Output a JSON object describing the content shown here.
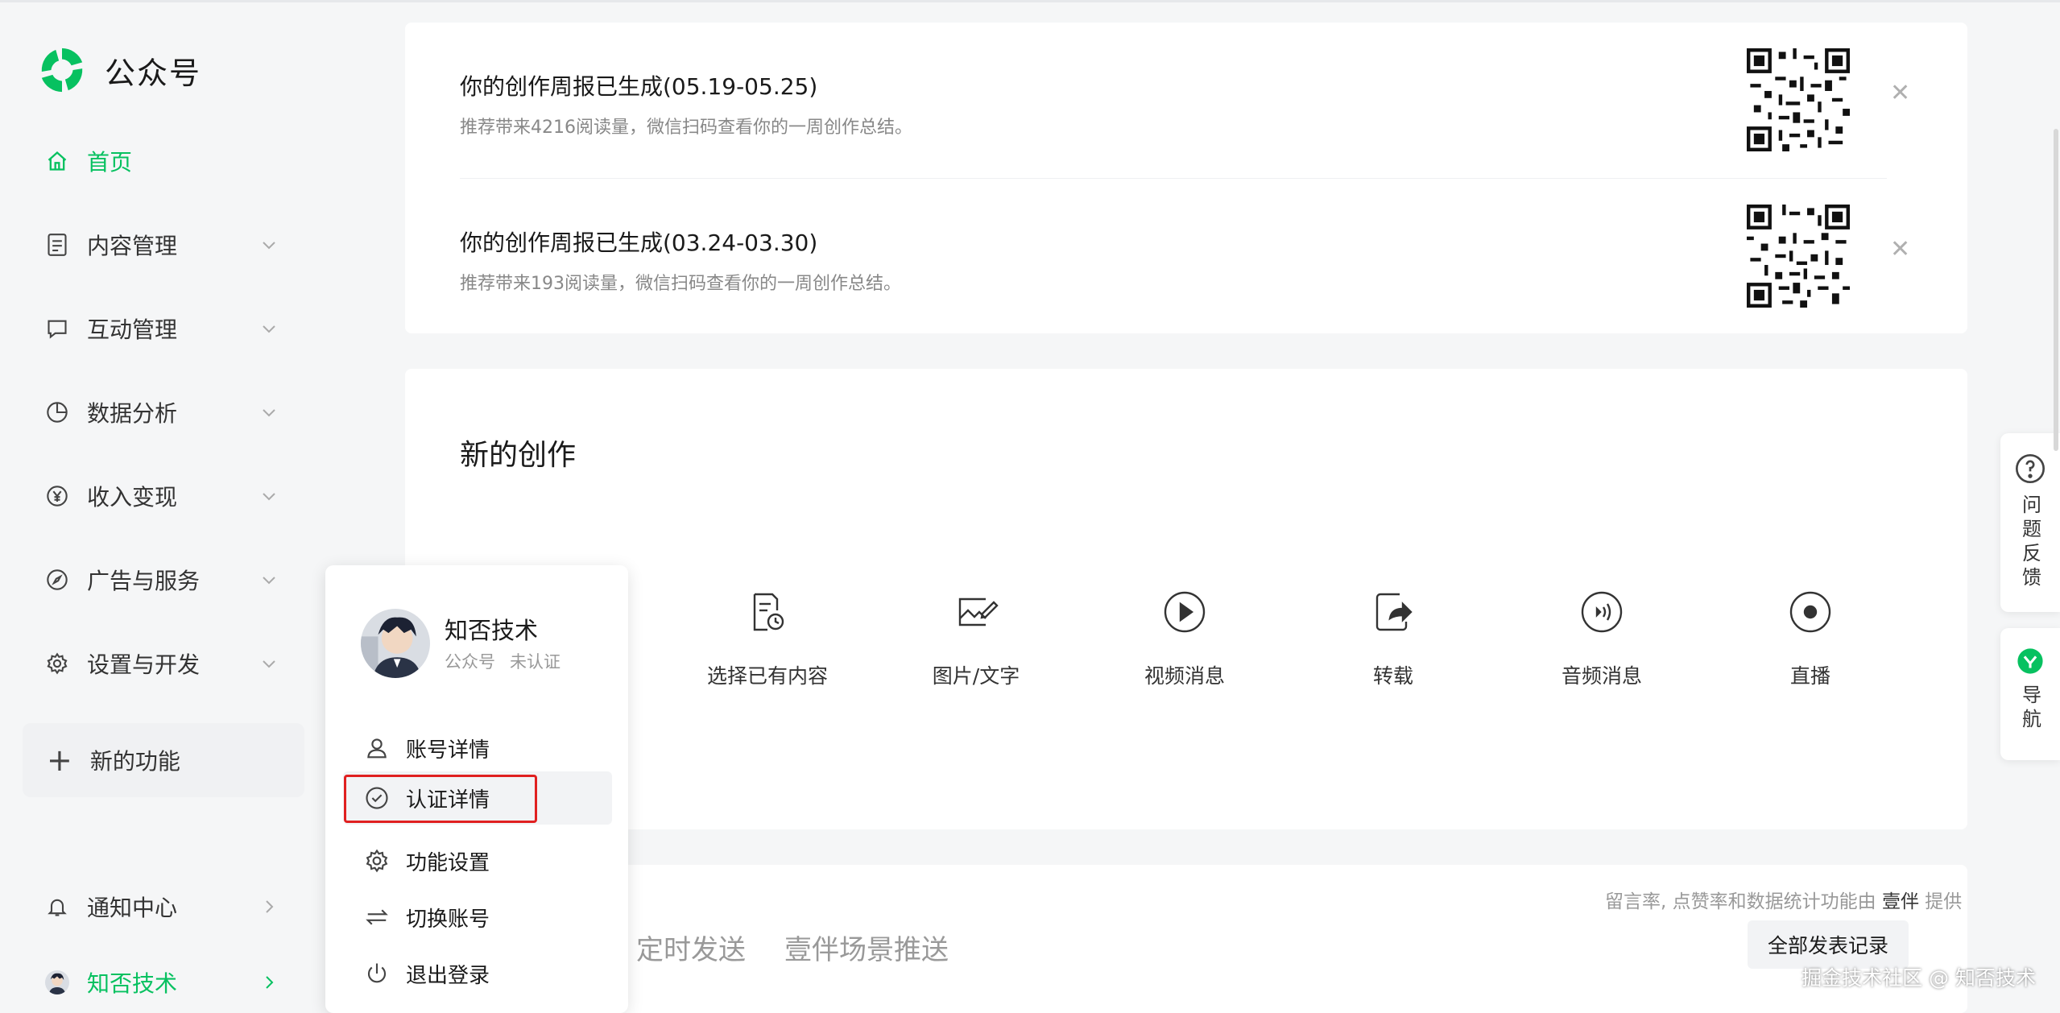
{
  "app": {
    "name": "公众号",
    "brand_color": "#07c160"
  },
  "sidebar": {
    "home": "首页",
    "items": [
      {
        "label": "内容管理",
        "icon": "document-icon"
      },
      {
        "label": "互动管理",
        "icon": "message-icon"
      },
      {
        "label": "数据分析",
        "icon": "pie-chart-icon"
      },
      {
        "label": "收入变现",
        "icon": "yen-icon"
      },
      {
        "label": "广告与服务",
        "icon": "compass-icon"
      },
      {
        "label": "设置与开发",
        "icon": "gear-icon"
      }
    ],
    "new_features": "新的功能",
    "notifications": "通知中心",
    "account_name": "知否技术"
  },
  "reports": [
    {
      "title": "你的创作周报已生成(05.19-05.25)",
      "desc": "推荐带来4216阅读量，微信扫码查看你的一周创作总结。"
    },
    {
      "title": "你的创作周报已生成(03.24-03.30)",
      "desc": "推荐带来193阅读量，微信扫码查看你的一周创作总结。"
    }
  ],
  "creation": {
    "title": "新的创作",
    "items": [
      {
        "label": "选择已有内容",
        "icon": "document-clock-icon"
      },
      {
        "label": "图片/文字",
        "icon": "image-edit-icon"
      },
      {
        "label": "视频消息",
        "icon": "play-circle-icon"
      },
      {
        "label": "转载",
        "icon": "share-icon"
      },
      {
        "label": "音频消息",
        "icon": "audio-wave-icon"
      },
      {
        "label": "直播",
        "icon": "live-icon"
      }
    ]
  },
  "publish": {
    "tab1": "定时发送",
    "tab2": "壹伴场景推送",
    "note_prefix": "留言率, 点赞率和数据统计功能由",
    "note_brand": "壹伴",
    "note_suffix": "提供",
    "all_records": "全部发表记录"
  },
  "float": {
    "feedback": "问题反馈",
    "navigation": "导航"
  },
  "popup": {
    "name": "知否技术",
    "type": "公众号",
    "status": "未认证",
    "menu": [
      {
        "label": "账号详情",
        "icon": "user-icon"
      },
      {
        "label": "认证详情",
        "icon": "check-circle-icon"
      },
      {
        "label": "功能设置",
        "icon": "gear-icon"
      },
      {
        "label": "切换账号",
        "icon": "switch-icon"
      },
      {
        "label": "退出登录",
        "icon": "power-icon"
      }
    ]
  },
  "watermark": "掘金技术社区 @ 知否技术"
}
